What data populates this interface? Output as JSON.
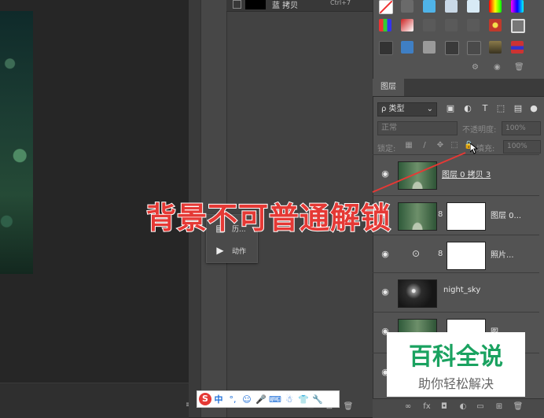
{
  "top_swatch": {
    "name": "蓝 拷贝",
    "shortcut": "Ctrl+7"
  },
  "history_panel": {
    "items": [
      {
        "label": "历..."
      },
      {
        "label": "动作"
      }
    ]
  },
  "layers": {
    "tab_label": "图层",
    "filter_value": "ρ 类型",
    "blend_mode": "正常",
    "opacity_label": "不透明度:",
    "opacity_value": "100%",
    "lock_label": "锁定:",
    "fill_label": "填充:",
    "fill_value": "100%",
    "rows": [
      {
        "name": "图层 0 拷贝 3"
      },
      {
        "name": "图层 0..."
      },
      {
        "name": "照片..."
      },
      {
        "name": "night_sky"
      },
      {
        "name": "图..."
      }
    ]
  },
  "ime": {
    "logo": "S",
    "mode": "中"
  },
  "overlay": {
    "caption": "背景不可普通解锁"
  },
  "watermark": {
    "title": "百科全说",
    "subtitle": "助你轻松解决"
  },
  "colors": {
    "caption_red": "#e53935",
    "watermark_green": "#1aa260",
    "panel_bg": "#535353"
  }
}
